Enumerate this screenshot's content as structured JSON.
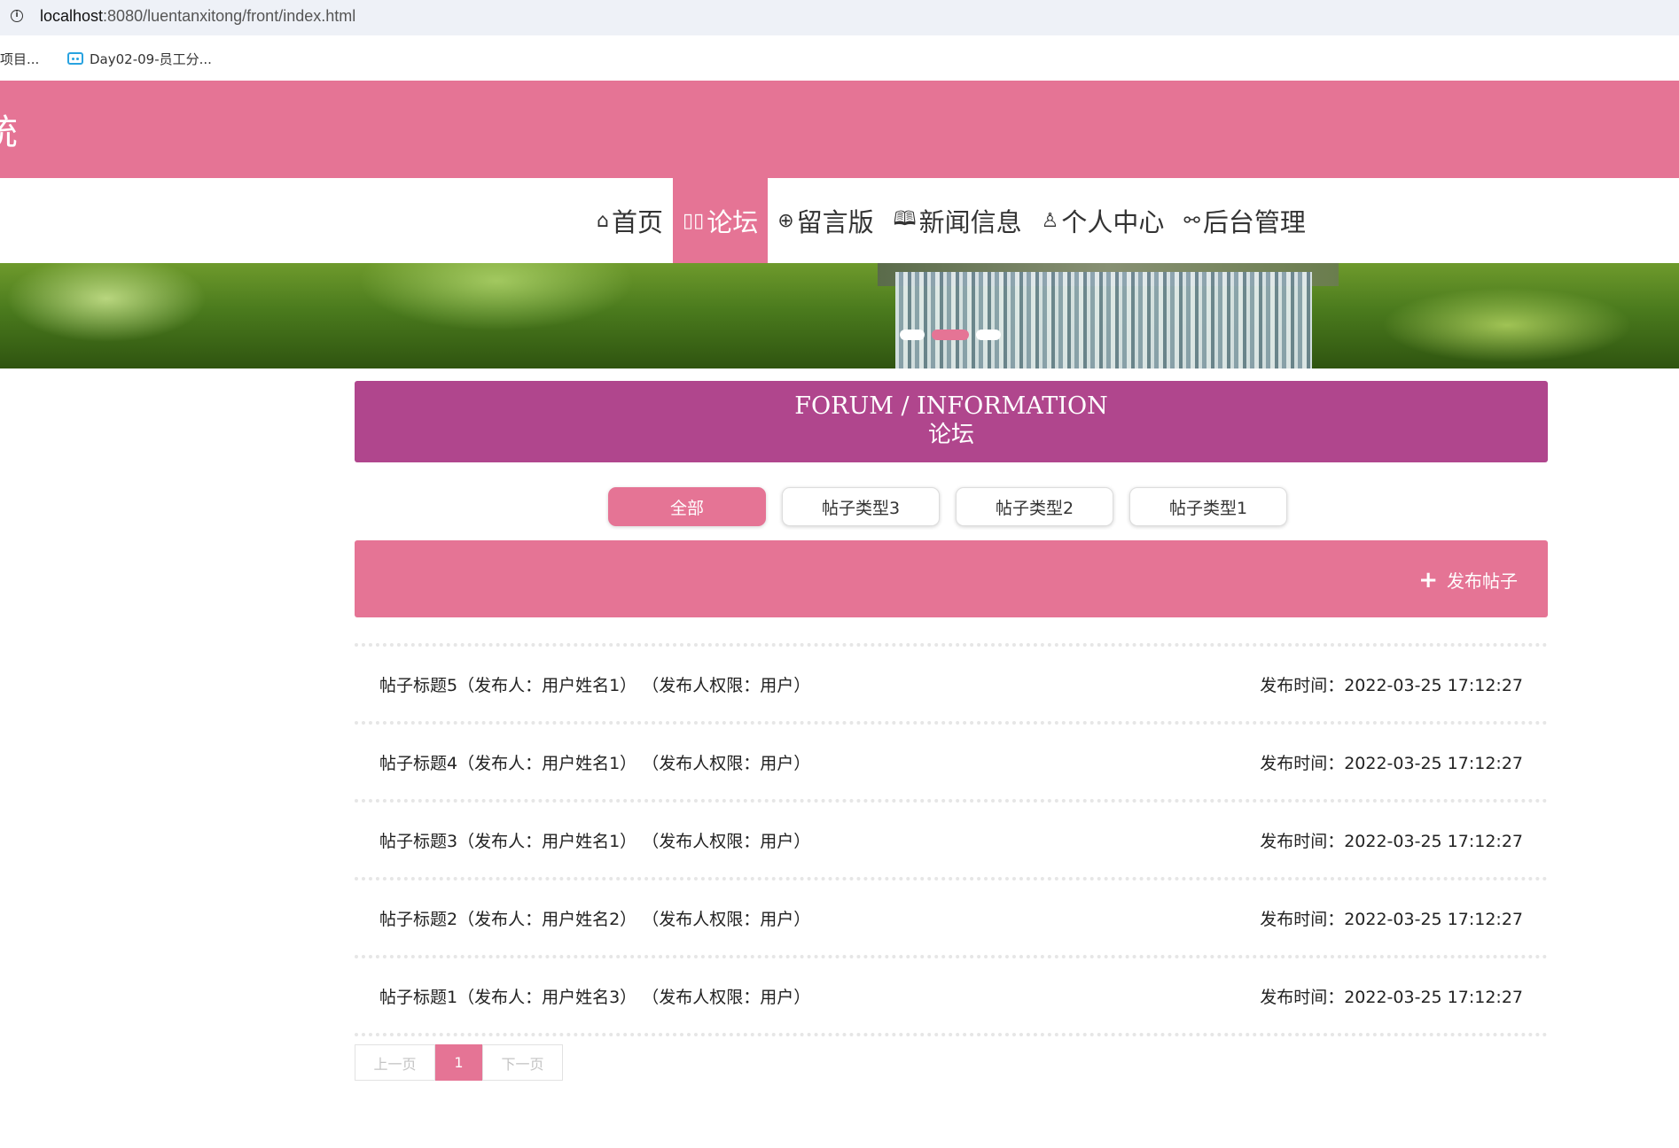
{
  "browser": {
    "url_host": "localhost",
    "url_rest": ":8080/luentanxitong/front/index.html",
    "bookmarks": [
      "项目...",
      "Day02-09-员工分..."
    ]
  },
  "header": {
    "site_title": "统",
    "colors": {
      "accent": "#e57495",
      "title_box": "#b0468d"
    }
  },
  "nav": {
    "items": [
      {
        "icon": "home-icon",
        "glyph": "⌂",
        "label": "首页"
      },
      {
        "icon": "forum-icon",
        "glyph": "▯▯",
        "label": "论坛"
      },
      {
        "icon": "globe-icon",
        "glyph": "⊕",
        "label": "留言版"
      },
      {
        "icon": "book-icon",
        "glyph": "🕮",
        "label": "新闻信息"
      },
      {
        "icon": "user-icon",
        "glyph": "♙",
        "label": "个人中心"
      },
      {
        "icon": "link-icon",
        "glyph": "⚯",
        "label": "后台管理"
      }
    ],
    "active_index": 1
  },
  "banner": {
    "slide_count": 3,
    "active_slide": 1
  },
  "section": {
    "title_en": "FORUM / INFORMATION",
    "title_cn": "论坛"
  },
  "tabs": [
    "全部",
    "帖子类型3",
    "帖子类型2",
    "帖子类型1"
  ],
  "publish": {
    "icon": "plus-icon",
    "label": "发布帖子"
  },
  "posts": [
    {
      "title": "帖子标题5（发布人：用户姓名1） （发布人权限：用户）",
      "time": "发布时间：2022-03-25 17:12:27"
    },
    {
      "title": "帖子标题4（发布人：用户姓名1） （发布人权限：用户）",
      "time": "发布时间：2022-03-25 17:12:27"
    },
    {
      "title": "帖子标题3（发布人：用户姓名1） （发布人权限：用户）",
      "time": "发布时间：2022-03-25 17:12:27"
    },
    {
      "title": "帖子标题2（发布人：用户姓名2） （发布人权限：用户）",
      "time": "发布时间：2022-03-25 17:12:27"
    },
    {
      "title": "帖子标题1（发布人：用户姓名3） （发布人权限：用户）",
      "time": "发布时间：2022-03-25 17:12:27"
    }
  ],
  "pager": {
    "prev": "上一页",
    "current": "1",
    "next": "下一页"
  }
}
